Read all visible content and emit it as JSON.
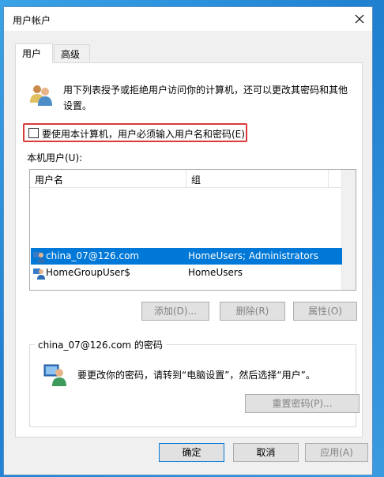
{
  "window": {
    "title": "用户帐户"
  },
  "tabs": [
    {
      "label": "用户"
    },
    {
      "label": "高级"
    }
  ],
  "description": "用下列表授予或拒绝用户访问你的计算机，还可以更改其密码和其他设置。",
  "must_login": {
    "label": "要使用本计算机，用户必须输入用户名和密码(E)",
    "checked": false
  },
  "local_users_label": "本机用户(U):",
  "users_table": {
    "columns": [
      "用户名",
      "组"
    ],
    "rows": [
      {
        "name": "china_07@126.com",
        "group": "HomeUsers; Administrators",
        "selected": true
      },
      {
        "name": "HomeGroupUser$",
        "group": "HomeUsers",
        "selected": false
      }
    ]
  },
  "user_buttons": {
    "add": "添加(D)...",
    "remove": "删除(R)",
    "properties": "属性(O)"
  },
  "password_group": {
    "legend": "china_07@126.com 的密码",
    "text": "要更改你的密码，请转到“电脑设置”，然后选择“用户”。",
    "reset_button": "重置密码(P)..."
  },
  "footer": {
    "ok": "确定",
    "cancel": "取消",
    "apply": "应用(A)"
  },
  "colors": {
    "selection": "#0078d7",
    "highlight_border": "#d93a3a"
  }
}
